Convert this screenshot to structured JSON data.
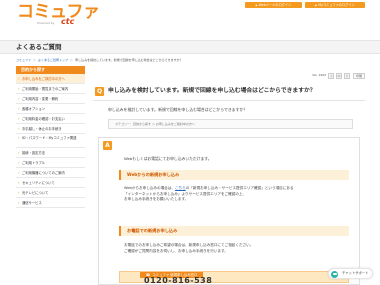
{
  "header": {
    "logo_text": "コミュファ",
    "logo_sub": "Powered by",
    "logo_brand": "ctc",
    "web_login": "Webメールのログイン",
    "my_login": "Myコミュファのログイン"
  },
  "page_title": "よくあるご質問",
  "breadcrumbs": [
    "コミュファ",
    "よくあるご質問トップ",
    "申し込みを検討しています。新規で回線を申し込む場合はどこからできますか？"
  ],
  "sidebar": {
    "heading": "目的から探す",
    "items": [
      {
        "label": "お申し込みをご検討中の方へ",
        "active": true
      },
      {
        "label": "ご利用開始・閲覧までのご案内",
        "active": false
      },
      {
        "label": "ご利用内容・変更・解約",
        "active": false
      },
      {
        "label": "各種オプション",
        "active": false
      },
      {
        "label": "ご利用料金の確認・お支払い",
        "active": false
      },
      {
        "label": "お引越し・休止のお手続き",
        "active": false
      },
      {
        "label": "ID・パスワード・Myコミュファ関連",
        "active": false
      },
      {
        "label": "接続・設定方法",
        "active": false
      },
      {
        "label": "ご利用トラブル",
        "active": false
      },
      {
        "label": "ご利用機器についてのご案内",
        "active": false
      },
      {
        "label": "セキュリティについて",
        "active": false
      },
      {
        "label": "光テレビについて",
        "active": false
      },
      {
        "label": "通信サービス",
        "active": false
      }
    ]
  },
  "toolbar": {
    "no_label": "No. 1905",
    "font_small": "小",
    "font_mid": "中",
    "font_large": "大",
    "print": "印刷"
  },
  "question": {
    "badge": "Q",
    "title": "申し込みを検討しています。新規で回線を申し込む場合はどこからできますか？",
    "body": "申し込みを検討しています。新規で回線を申し込む場合はどこからできますか？",
    "category": "カテゴリー：目的から探す ＞ お申し込みをご検討中の方へ"
  },
  "answer": {
    "badge": "A",
    "intro": "Webもしくはお電話にてお申し込みいただけます。",
    "web_heading": "Webからの新規お申し込み",
    "web_text_1": "Webからお申し込みの場合は、",
    "web_link": "こちら",
    "web_text_2": "の「新規お申し込み・サービス提供エリア確認」という項目にある",
    "web_text_3": "「インターネットからお申し込み」よりサービス提供エリアをご確認の上、",
    "web_text_4": "お申し込み手続きをお願いいたします。",
    "tel_heading": "お電話での新規お申し込み",
    "tel_text_1": "お電話でのお申し込みご希望の場合は、新規申し込み窓口にてご相談ください。",
    "tel_text_2": "ご確認がご質問内容をお伺いし、お申し込み手続きを行います。",
    "call_banner": "コミュファ 新規申し込み窓口",
    "phone": "0120-816-538"
  },
  "chat": {
    "label": "チャットサポート"
  }
}
